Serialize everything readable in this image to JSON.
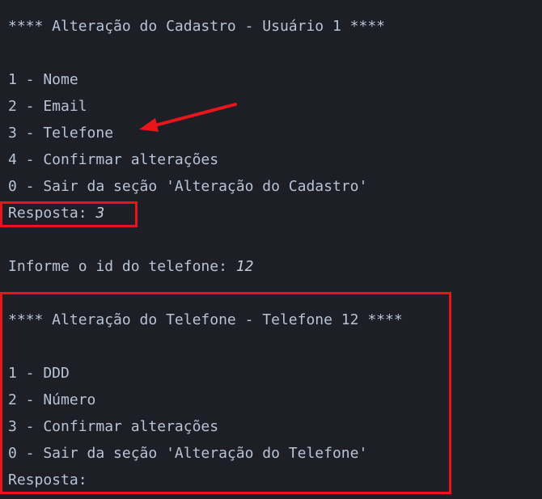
{
  "terminal": {
    "header1": "**** Alteração do Cadastro - Usuário 1 ****",
    "menu1": [
      "1 - Nome",
      "2 - Email",
      "3 - Telefone",
      "4 - Confirmar alterações",
      "0 - Sair da seção 'Alteração do Cadastro'"
    ],
    "prompt1_label": "Resposta: ",
    "prompt1_value": "3",
    "id_prompt_label": "Informe o id do telefone: ",
    "id_prompt_value": "12",
    "header2": "**** Alteração do Telefone - Telefone 12 ****",
    "menu2": [
      "1 - DDD",
      "2 - Número",
      "3 - Confirmar alterações",
      "0 - Sair da seção 'Alteração do Telefone'"
    ],
    "prompt2_label": "Resposta:"
  },
  "annotations": {
    "highlight_color": "#e8161b",
    "arrow_icon": "red-arrow-icon"
  }
}
